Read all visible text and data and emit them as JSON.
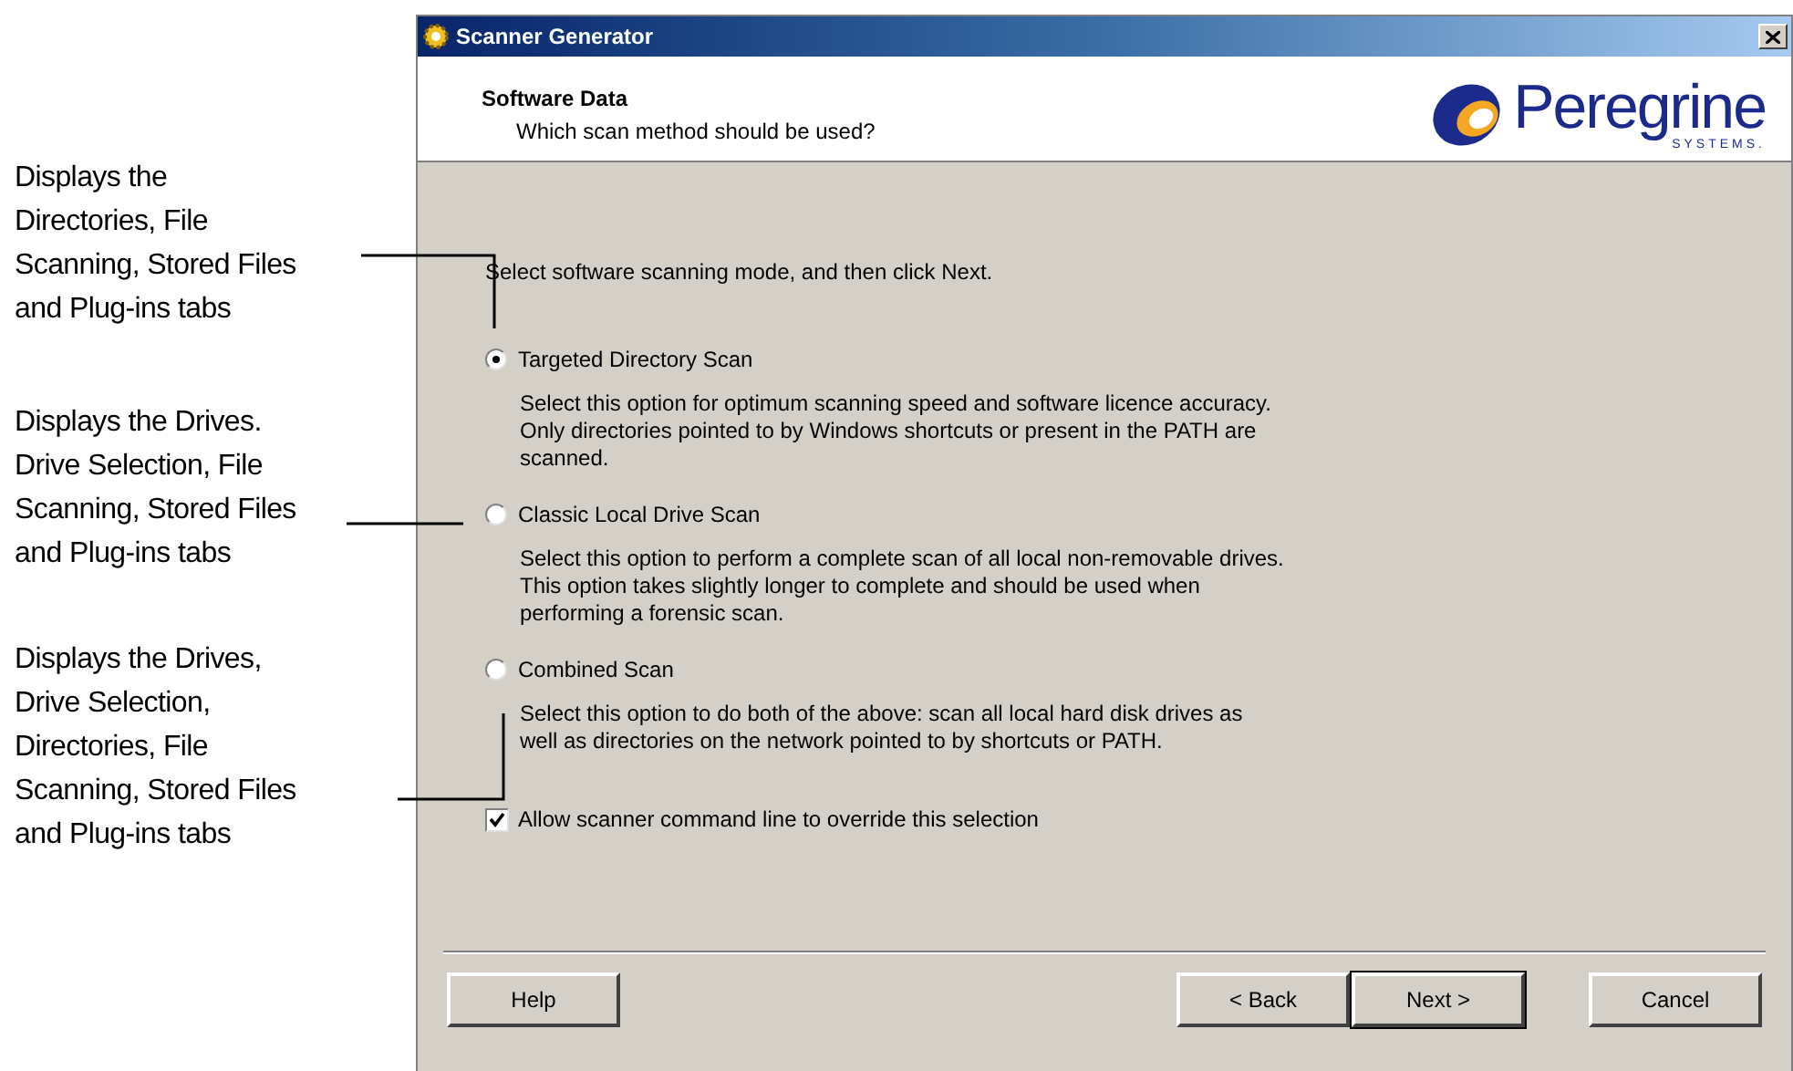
{
  "annotations": [
    {
      "text": "Displays the\nDirectories, File\nScanning, Stored Files\nand Plug-ins tabs"
    },
    {
      "text": "Displays the Drives.\nDrive Selection, File\nScanning, Stored Files\nand Plug-ins tabs"
    },
    {
      "text": "Displays the Drives,\nDrive Selection,\nDirectories, File\nScanning, Stored Files\nand Plug-ins tabs"
    }
  ],
  "window": {
    "title": "Scanner Generator"
  },
  "header": {
    "title": "Software Data",
    "subtitle": "Which scan method should be used?",
    "logo": {
      "name": "Peregrine",
      "tagline": "SYSTEMS."
    }
  },
  "instruction": "Select software scanning mode, and then click Next.",
  "options": [
    {
      "label": "Targeted Directory Scan",
      "selected": true,
      "description": "Select this option for optimum scanning speed and software licence accuracy.\nOnly directories pointed to by Windows shortcuts or present in the PATH are\nscanned."
    },
    {
      "label": "Classic Local Drive Scan",
      "selected": false,
      "description": "Select this option to perform a complete scan of all local non-removable drives.\nThis option takes slightly longer to complete and should be used when\nperforming a forensic scan."
    },
    {
      "label": "Combined Scan",
      "selected": false,
      "description": "Select this option to do both of the above: scan all local hard disk drives as\nwell as directories on the network pointed to by shortcuts or PATH."
    }
  ],
  "override": {
    "label": "Allow scanner command line to override this selection",
    "checked": true
  },
  "buttons": [
    {
      "label": "Help",
      "default": false
    },
    {
      "label": "< Back",
      "default": false
    },
    {
      "label": "Next >",
      "default": true
    },
    {
      "label": "Cancel",
      "default": false
    }
  ]
}
